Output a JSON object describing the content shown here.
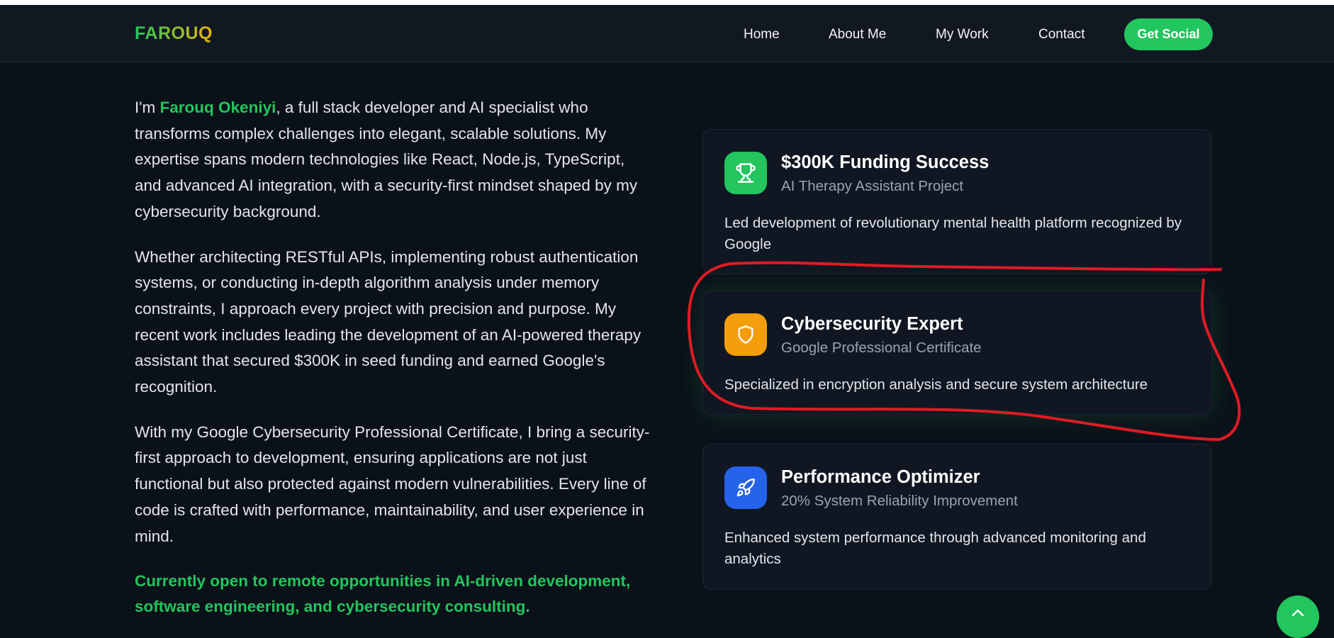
{
  "nav": {
    "logo": "FAROUQ",
    "links": [
      "Home",
      "About Me",
      "My Work",
      "Contact"
    ],
    "cta": "Get Social"
  },
  "about": {
    "p1_prefix": "I'm ",
    "p1_name": "Farouq Okeniyi",
    "p1_rest": ", a full stack developer and AI specialist who transforms complex challenges into elegant, scalable solutions. My expertise spans modern technologies like React, Node.js, TypeScript, and advanced AI integration, with a security-first mindset shaped by my cybersecurity background.",
    "p2": "Whether architecting RESTful APIs, implementing robust authentication systems, or conducting in-depth algorithm analysis under memory constraints, I approach every project with precision and purpose. My recent work includes leading the development of an AI-powered therapy assistant that secured $300K in seed funding and earned Google's recognition.",
    "p3": "With my Google Cybersecurity Professional Certificate, I bring a security-first approach to development, ensuring applications are not just functional but also protected against modern vulnerabilities. Every line of code is crafted with performance, maintainability, and user experience in mind.",
    "cta": "Currently open to remote opportunities in AI-driven development, software engineering, and cybersecurity consulting."
  },
  "cards": [
    {
      "icon": "trophy-icon",
      "title": "$300K Funding Success",
      "subtitle": "AI Therapy Assistant Project",
      "description": "Led development of revolutionary mental health platform recognized by Google"
    },
    {
      "icon": "shield-icon",
      "title": "Cybersecurity Expert",
      "subtitle": "Google Professional Certificate",
      "description": "Specialized in encryption analysis and secure system architecture"
    },
    {
      "icon": "rocket-icon",
      "title": "Performance Optimizer",
      "subtitle": "20% System Reliability Improvement",
      "description": "Enhanced system performance through advanced monitoring and analytics"
    }
  ],
  "colors": {
    "background": "#0b1119",
    "navbar": "#111822",
    "accent_green": "#22c55e",
    "card_background": "#101722",
    "annotation_red": "#e01b24"
  }
}
